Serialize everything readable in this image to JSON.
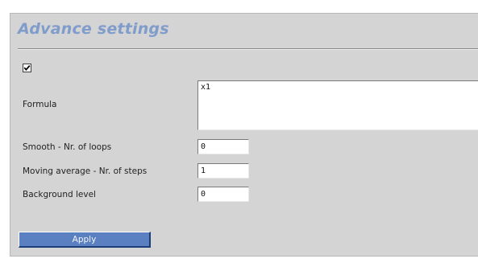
{
  "panel": {
    "title": "Advance settings",
    "enabled_checked": true
  },
  "formula": {
    "label": "Formula",
    "value": "x1"
  },
  "smooth": {
    "label": "Smooth - Nr. of loops",
    "value": "0"
  },
  "moving_average": {
    "label": "Moving average - Nr. of steps",
    "value": "1"
  },
  "background_level": {
    "label": "Background level",
    "value": "0"
  },
  "actions": {
    "apply_label": "Apply"
  },
  "colors": {
    "panel_bg": "#d4d4d4",
    "title": "#7f9ccb",
    "button_bg": "#5b80c2"
  },
  "icons": {
    "enabled_checkbox": "checkmark-icon"
  }
}
